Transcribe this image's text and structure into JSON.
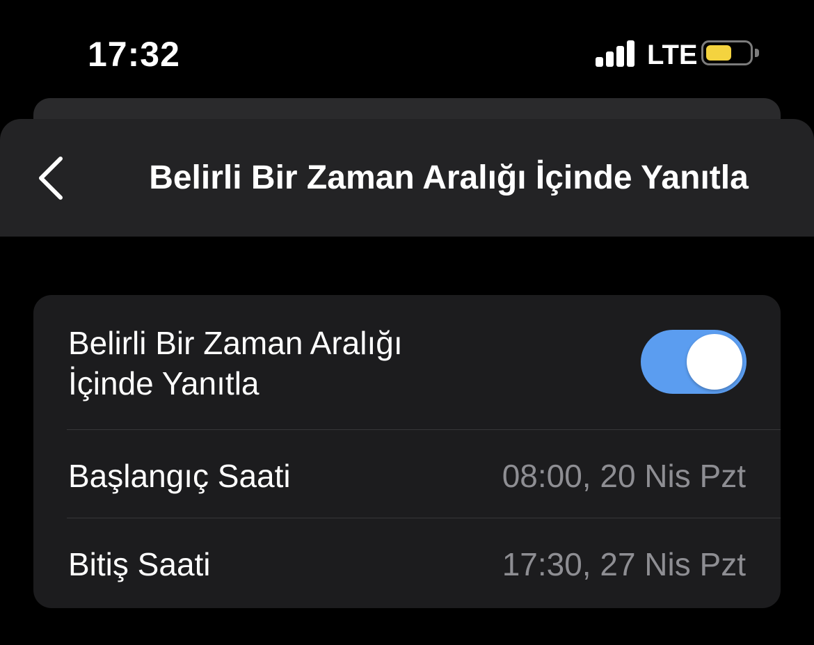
{
  "status_bar": {
    "time": "17:32",
    "network": "LTE",
    "battery_color": "#f4d33f",
    "battery_level": 0.6
  },
  "nav": {
    "back_icon": "chevron-left-icon",
    "title": "Belirli Bir Zaman Aralığı İçinde Yanıtla"
  },
  "settings": {
    "toggle_row": {
      "label_line1": "Belirli Bir Zaman Aralığı",
      "label_line2": "İçinde Yanıtla",
      "enabled": true,
      "accent": "#5b9df0"
    },
    "rows": [
      {
        "label": "Başlangıç Saati",
        "value": "08:00, 20 Nis Pzt"
      },
      {
        "label": "Bitiş Saati",
        "value": "17:30, 27 Nis Pzt"
      }
    ]
  }
}
